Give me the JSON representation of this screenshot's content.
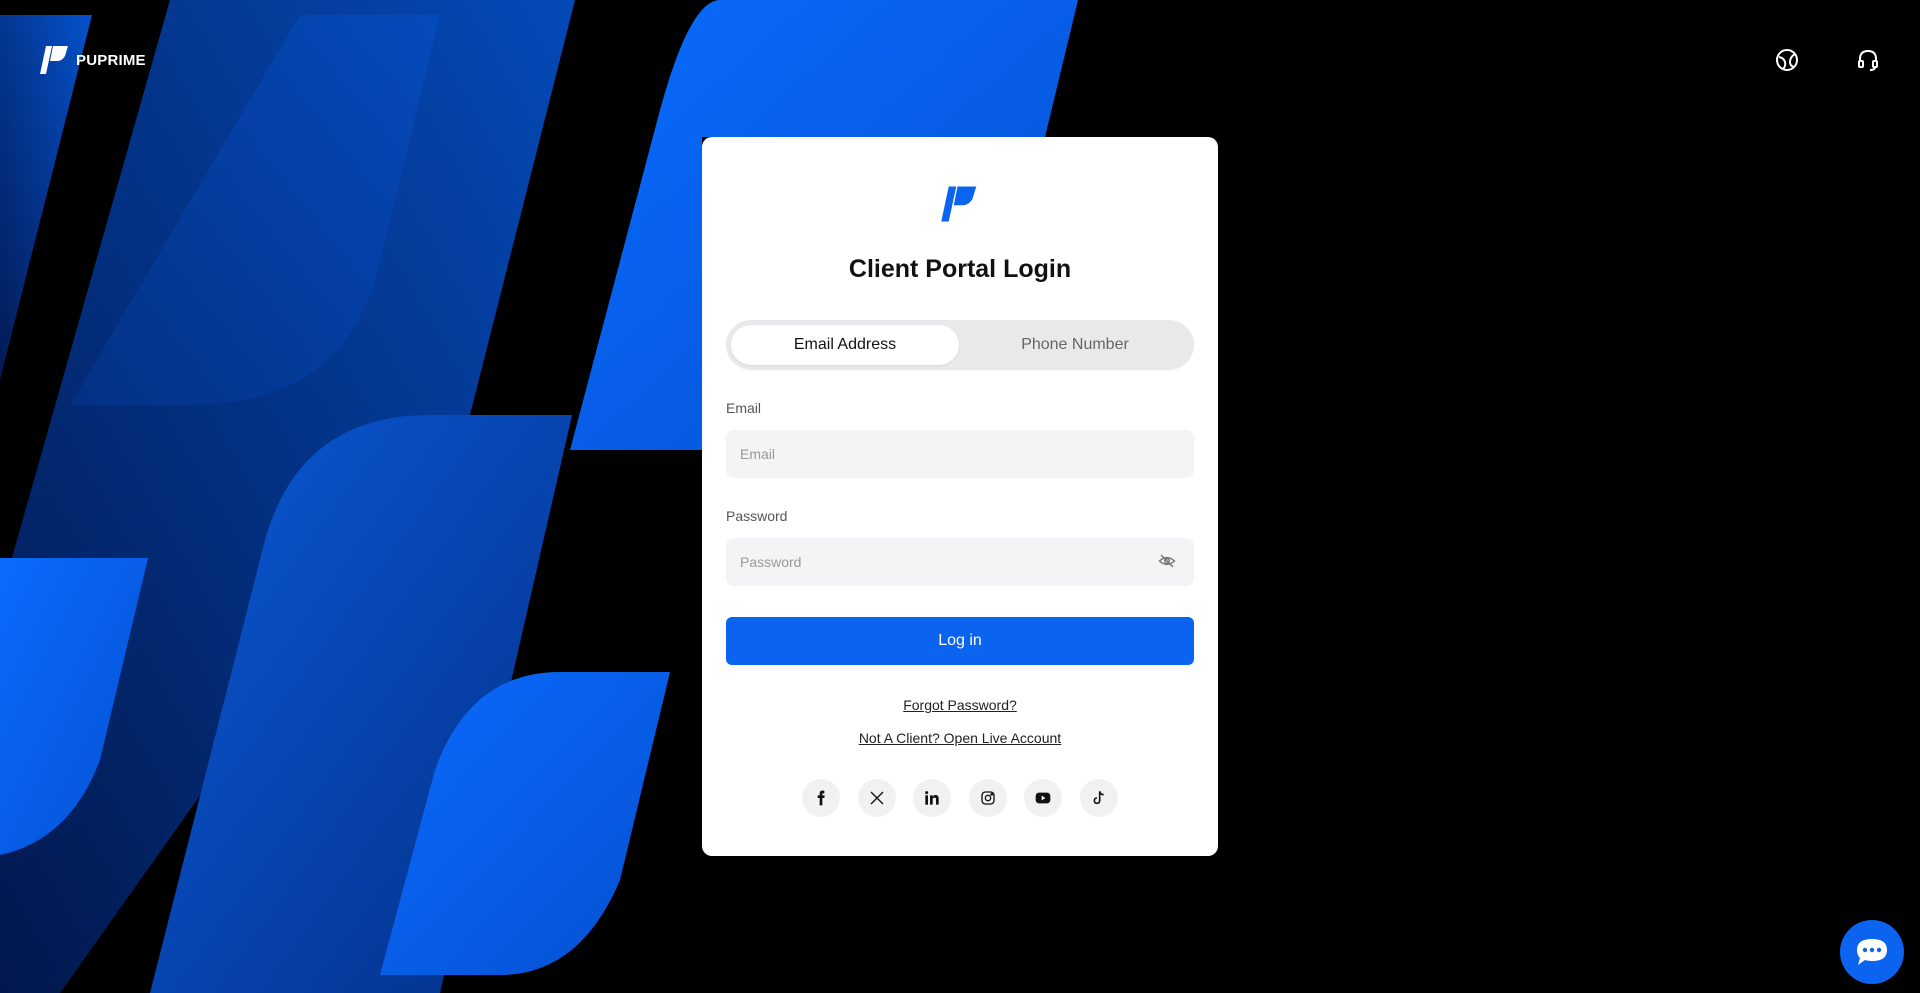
{
  "brand": {
    "name": "PUPRIME"
  },
  "topbar": {
    "language_icon": "globe-icon",
    "support_icon": "headset-icon"
  },
  "login": {
    "title": "Client Portal Login",
    "tabs": [
      {
        "label": "Email Address",
        "active": true
      },
      {
        "label": "Phone Number",
        "active": false
      }
    ],
    "email": {
      "label": "Email",
      "placeholder": "Email",
      "value": ""
    },
    "password": {
      "label": "Password",
      "placeholder": "Password",
      "value": ""
    },
    "submit_label": "Log in",
    "forgot_label": "Forgot Password?",
    "open_account_label": "Not A Client? Open Live Account",
    "socials": [
      "facebook-icon",
      "x-icon",
      "linkedin-icon",
      "instagram-icon",
      "youtube-icon",
      "tiktok-icon"
    ]
  },
  "colors": {
    "accent": "#0a64f0",
    "background": "#000000",
    "card": "#ffffff"
  },
  "chat": {
    "icon": "chat-bubble-icon"
  }
}
